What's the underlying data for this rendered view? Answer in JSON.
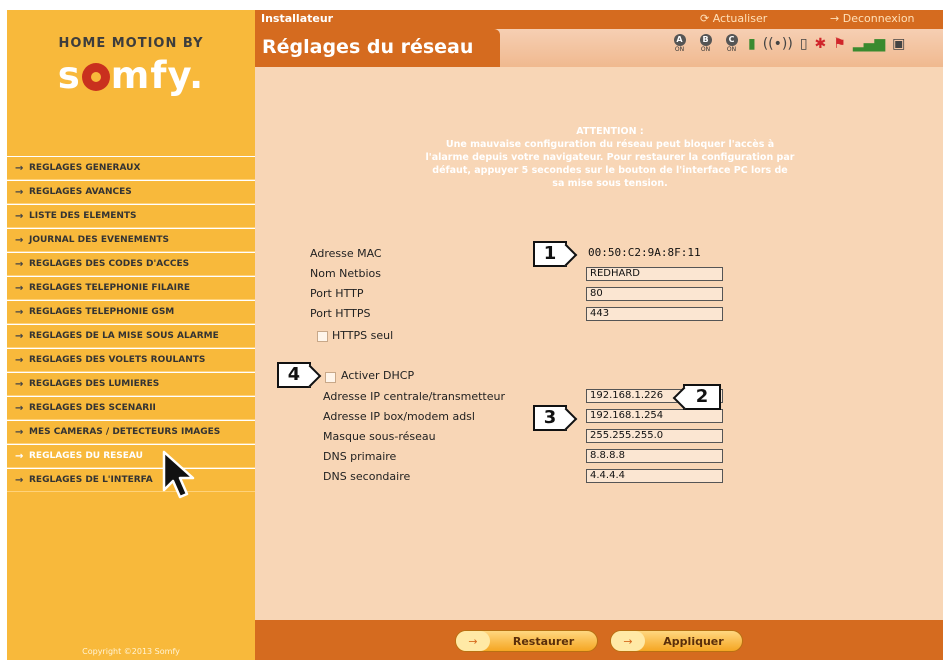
{
  "sidebar": {
    "brand": "HOME MOTION BY",
    "logo": "somfy.",
    "items": [
      {
        "label": "REGLAGES GENERAUX"
      },
      {
        "label": "REGLAGES AVANCES"
      },
      {
        "label": "LISTE DES ELEMENTS"
      },
      {
        "label": "JOURNAL DES EVENEMENTS"
      },
      {
        "label": "REGLAGES DES CODES D'ACCES"
      },
      {
        "label": "REGLAGES TELEPHONIE FILAIRE"
      },
      {
        "label": "REGLAGES TELEPHONIE GSM"
      },
      {
        "label": "REGLAGES DE LA MISE SOUS ALARME"
      },
      {
        "label": "REGLAGES DES VOLETS ROULANTS"
      },
      {
        "label": "REGLAGES DES LUMIERES"
      },
      {
        "label": "REGLAGES DES SCENARII"
      },
      {
        "label": "MES CAMERAS / DETECTEURS IMAGES"
      },
      {
        "label": "REGLAGES DU RESEAU"
      },
      {
        "label": "REGLAGES DE L'INTERFA"
      }
    ],
    "active_index": 12,
    "copyright": "Copyright ©2013 Somfy"
  },
  "topbar": {
    "role": "Installateur",
    "refresh": "Actualiser",
    "logout": "Deconnexion"
  },
  "header": {
    "title": "Réglages du réseau",
    "zones": [
      {
        "letter": "A",
        "state": "ON"
      },
      {
        "letter": "B",
        "state": "ON"
      },
      {
        "letter": "C",
        "state": "ON"
      }
    ]
  },
  "main": {
    "warning_title": "ATTENTION :",
    "warning_text": "Une mauvaise configuration du réseau peut bloquer l'accès à l'alarme depuis votre navigateur. Pour restaurer la configuration par défaut, appuyer 5 secondes sur le bouton de l'interface PC lors de sa mise sous tension.",
    "mac_label": "Adresse MAC",
    "mac_value": "00:50:C2:9A:8F:11",
    "netbios_label": "Nom Netbios",
    "netbios_value": "REDHARD",
    "http_label": "Port HTTP",
    "http_value": "80",
    "https_label": "Port HTTPS",
    "https_value": "443",
    "https_only_label": "HTTPS seul",
    "dhcp_label": "Activer DHCP",
    "ip_central_label": "Adresse IP centrale/transmetteur",
    "ip_central_value": "192.168.1.226",
    "ip_box_label": "Adresse IP box/modem adsl",
    "ip_box_value": "192.168.1.254",
    "mask_label": "Masque sous-réseau",
    "mask_value": "255.255.255.0",
    "dns1_label": "DNS primaire",
    "dns1_value": "8.8.8.8",
    "dns2_label": "DNS secondaire",
    "dns2_value": "4.4.4.4"
  },
  "footer": {
    "restore": "Restaurer",
    "apply": "Appliquer"
  },
  "callouts": {
    "c1": "1",
    "c2": "2",
    "c3": "3",
    "c4": "4"
  },
  "colors": {
    "sidebar": "#f8b93b",
    "accent": "#d56b1f",
    "content_bg": "#f8d6b6"
  }
}
